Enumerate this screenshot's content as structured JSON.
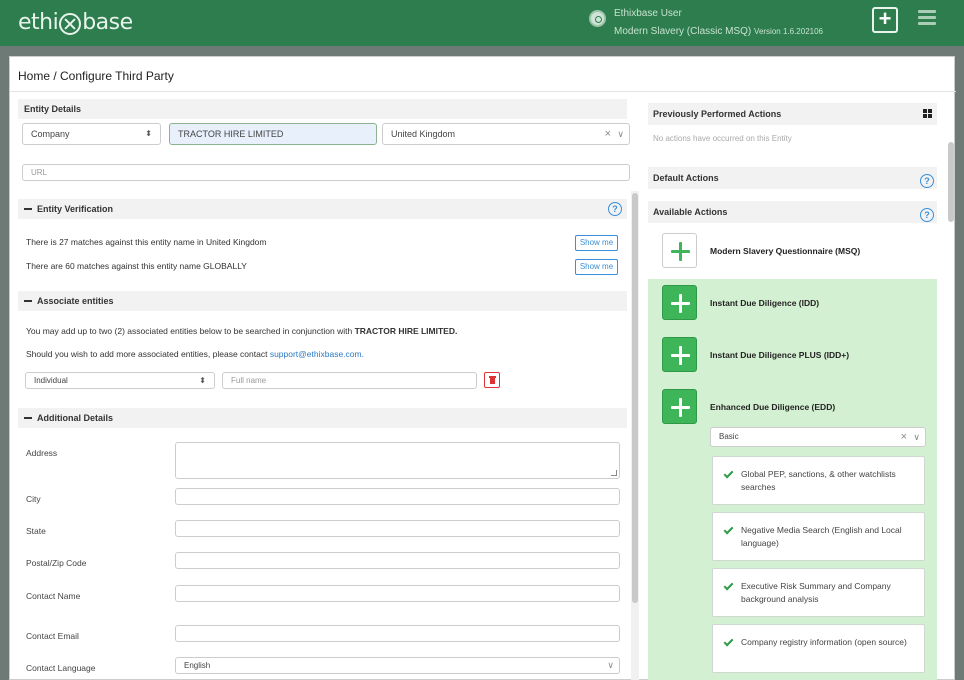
{
  "header": {
    "brand_left": "ethi",
    "brand_right": "base",
    "user_name": "Ethixbase User",
    "user_subtitle": "Modern Slavery (Classic MSQ)",
    "version": "Version 1.6.202106"
  },
  "page": {
    "breadcrumb": "Home / Configure Third Party"
  },
  "entity_details": {
    "heading": "Entity Details",
    "type": "Company",
    "name": "TRACTOR HIRE LIMITED",
    "country": "United Kingdom",
    "url_placeholder": "URL"
  },
  "verification": {
    "heading": "Entity Verification",
    "line1": "There is 27 matches against this entity name in United Kingdom",
    "line2": "There are 60 matches against this entity name GLOBALLY",
    "show_me": "Show me"
  },
  "associates": {
    "heading": "Associate entities",
    "intro_prefix": "You may add up to two (2) associated entities below to be searched in conjunction with ",
    "intro_entity": "TRACTOR HIRE LIMITED.",
    "contact_prefix": "Should you wish to add more associated entities, please contact ",
    "contact_email": "support@ethixbase.com.",
    "type": "Individual",
    "name_placeholder": "Full name"
  },
  "additional": {
    "heading": "Additional Details",
    "address": "Address",
    "city": "City",
    "state": "State",
    "postal": "Postal/Zip Code",
    "contact_name": "Contact Name",
    "contact_email": "Contact Email",
    "contact_language": "Contact Language",
    "language_value": "English"
  },
  "right_panel": {
    "previous_heading": "Previously Performed Actions",
    "previous_empty": "No actions have occurred on this Entity",
    "default_heading": "Default Actions",
    "available_heading": "Available Actions",
    "actions": [
      {
        "label": "Modern Slavery Questionnaire (MSQ)"
      },
      {
        "label": "Instant Due Diligence (IDD)"
      },
      {
        "label": "Instant Due Diligence PLUS (IDD+)"
      },
      {
        "label": "Enhanced Due Diligence (EDD)"
      }
    ],
    "edd_level": "Basic",
    "edd_items": [
      "Global PEP, sanctions, & other watchlists searches",
      "Negative Media Search (English and Local language)",
      "Executive Risk Summary and Company background analysis",
      "Company registry information (open source)"
    ]
  },
  "colors": {
    "brand_green": "#2e7d4f",
    "action_green": "#3fb559",
    "panel_green": "#d4f0d2",
    "link_blue": "#2a7ac4"
  }
}
